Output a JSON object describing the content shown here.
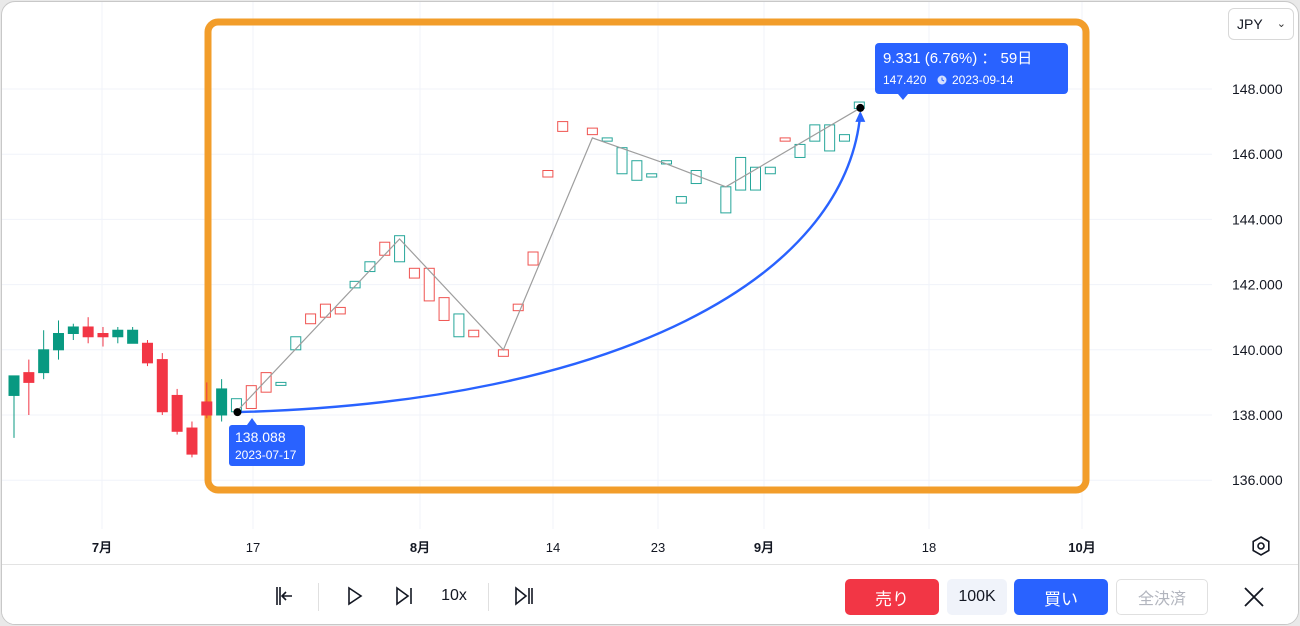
{
  "currency": {
    "selected": "JPY"
  },
  "chart_data": {
    "type": "candlestick",
    "y_axis": {
      "range": [
        134.7,
        149.3
      ],
      "ticks": [
        "148.000",
        "146.000",
        "144.000",
        "142.000",
        "140.000",
        "138.000",
        "136.000"
      ]
    },
    "x_axis": {
      "ticks": [
        "7月",
        "17",
        "8月",
        "14",
        "23",
        "9月",
        "18",
        "10月"
      ]
    },
    "candles": [
      {
        "bar": 0,
        "open": 138.6,
        "high": 138.9,
        "low": 137.3,
        "close": 139.2,
        "color": "green"
      },
      {
        "bar": 1,
        "open": 139.0,
        "high": 139.7,
        "low": 138.0,
        "close": 139.3,
        "color": "red"
      },
      {
        "bar": 2,
        "open": 139.3,
        "high": 140.6,
        "low": 139.1,
        "close": 140.0,
        "color": "green"
      },
      {
        "bar": 3,
        "open": 140.0,
        "high": 140.9,
        "low": 139.7,
        "close": 140.5,
        "color": "green"
      },
      {
        "bar": 4,
        "open": 140.5,
        "high": 140.8,
        "low": 140.3,
        "close": 140.7,
        "color": "green"
      },
      {
        "bar": 5,
        "open": 140.7,
        "high": 141.0,
        "low": 140.2,
        "close": 140.4,
        "color": "red"
      },
      {
        "bar": 6,
        "open": 140.5,
        "high": 140.7,
        "low": 140.1,
        "close": 140.4,
        "color": "red"
      },
      {
        "bar": 7,
        "open": 140.4,
        "high": 140.7,
        "low": 140.2,
        "close": 140.6,
        "color": "green"
      },
      {
        "bar": 8,
        "open": 140.6,
        "high": 140.7,
        "low": 140.3,
        "close": 140.2,
        "color": "green"
      },
      {
        "bar": 9,
        "open": 140.2,
        "high": 140.3,
        "low": 139.5,
        "close": 139.6,
        "color": "red"
      },
      {
        "bar": 10,
        "open": 139.7,
        "high": 139.9,
        "low": 138.0,
        "close": 138.1,
        "color": "red"
      },
      {
        "bar": 11,
        "open": 138.6,
        "high": 138.8,
        "low": 137.4,
        "close": 137.5,
        "color": "red"
      },
      {
        "bar": 12,
        "open": 137.6,
        "high": 137.8,
        "low": 136.7,
        "close": 136.8,
        "color": "red"
      },
      {
        "bar": 13,
        "open": 138.4,
        "high": 139.0,
        "low": 137.9,
        "close": 138.0,
        "color": "red"
      },
      {
        "bar": 14,
        "open": 138.0,
        "high": 139.1,
        "low": 137.8,
        "close": 138.8,
        "color": "green"
      },
      {
        "bar": 15,
        "open": 138.5,
        "high": 138.6,
        "low": 137.9,
        "close": 138.1,
        "color": "green"
      },
      {
        "bar": 16,
        "open": 138.2,
        "high": 139.0,
        "low": 138.1,
        "close": 138.9,
        "color": "red"
      },
      {
        "bar": 17,
        "open": 138.7,
        "high": 139.3,
        "low": 138.6,
        "close": 139.3,
        "color": "red"
      },
      {
        "bar": 18,
        "open": 139.0,
        "high": 139.1,
        "low": 138.9,
        "close": 139.0,
        "color": "green"
      },
      {
        "bar": 19,
        "open": 140.0,
        "high": 140.5,
        "low": 139.9,
        "close": 140.4,
        "color": "green"
      },
      {
        "bar": 20,
        "open": 140.8,
        "high": 141.1,
        "low": 140.8,
        "close": 141.1,
        "color": "red"
      },
      {
        "bar": 21,
        "open": 141.0,
        "high": 141.4,
        "low": 140.9,
        "close": 141.4,
        "color": "red"
      },
      {
        "bar": 22,
        "open": 141.1,
        "high": 141.3,
        "low": 140.9,
        "close": 141.3,
        "color": "red"
      },
      {
        "bar": 23,
        "open": 141.9,
        "high": 142.1,
        "low": 141.8,
        "close": 142.1,
        "color": "green"
      },
      {
        "bar": 24,
        "open": 142.4,
        "high": 142.7,
        "low": 142.3,
        "close": 142.7,
        "color": "green"
      },
      {
        "bar": 25,
        "open": 142.9,
        "high": 143.3,
        "low": 142.9,
        "close": 143.3,
        "color": "red"
      },
      {
        "bar": 26,
        "open": 142.7,
        "high": 143.5,
        "low": 142.7,
        "close": 143.5,
        "color": "green"
      },
      {
        "bar": 27,
        "open": 142.2,
        "high": 142.5,
        "low": 142.2,
        "close": 142.5,
        "color": "red"
      },
      {
        "bar": 28,
        "open": 141.5,
        "high": 142.5,
        "low": 141.5,
        "close": 142.5,
        "color": "red"
      },
      {
        "bar": 29,
        "open": 140.9,
        "high": 141.6,
        "low": 140.9,
        "close": 141.6,
        "color": "red"
      },
      {
        "bar": 30,
        "open": 140.4,
        "high": 141.1,
        "low": 140.4,
        "close": 141.1,
        "color": "green"
      },
      {
        "bar": 31,
        "open": 140.4,
        "high": 140.6,
        "low": 140.4,
        "close": 140.6,
        "color": "red"
      },
      {
        "bar": 33,
        "open": 139.8,
        "high": 140.0,
        "low": 139.8,
        "close": 140.0,
        "color": "red"
      },
      {
        "bar": 34,
        "open": 141.2,
        "high": 141.4,
        "low": 141.2,
        "close": 141.4,
        "color": "red"
      },
      {
        "bar": 35,
        "open": 142.6,
        "high": 143.0,
        "low": 142.6,
        "close": 143.0,
        "color": "red"
      },
      {
        "bar": 36,
        "open": 145.3,
        "high": 145.5,
        "low": 145.3,
        "close": 145.5,
        "color": "red"
      },
      {
        "bar": 37,
        "open": 146.7,
        "high": 147.0,
        "low": 146.7,
        "close": 147.0,
        "color": "red"
      },
      {
        "bar": 39,
        "open": 146.6,
        "high": 146.8,
        "low": 146.6,
        "close": 146.8,
        "color": "red"
      },
      {
        "bar": 40,
        "open": 146.4,
        "high": 146.5,
        "low": 146.4,
        "close": 146.5,
        "color": "green"
      },
      {
        "bar": 41,
        "open": 145.4,
        "high": 146.2,
        "low": 145.4,
        "close": 146.2,
        "color": "green"
      },
      {
        "bar": 42,
        "open": 145.2,
        "high": 145.8,
        "low": 145.2,
        "close": 145.8,
        "color": "green"
      },
      {
        "bar": 43,
        "open": 145.3,
        "high": 145.4,
        "low": 145.3,
        "close": 145.4,
        "color": "green"
      },
      {
        "bar": 44,
        "open": 145.7,
        "high": 145.8,
        "low": 145.7,
        "close": 145.8,
        "color": "green"
      },
      {
        "bar": 45,
        "open": 144.5,
        "high": 144.7,
        "low": 144.5,
        "close": 144.7,
        "color": "green"
      },
      {
        "bar": 46,
        "open": 145.1,
        "high": 145.5,
        "low": 145.1,
        "close": 145.5,
        "color": "green"
      },
      {
        "bar": 48,
        "open": 144.2,
        "high": 145.0,
        "low": 144.2,
        "close": 145.0,
        "color": "green"
      },
      {
        "bar": 49,
        "open": 144.9,
        "high": 145.9,
        "low": 144.9,
        "close": 145.9,
        "color": "green"
      },
      {
        "bar": 50,
        "open": 144.9,
        "high": 145.6,
        "low": 144.9,
        "close": 145.6,
        "color": "green"
      },
      {
        "bar": 51,
        "open": 145.4,
        "high": 145.6,
        "low": 145.4,
        "close": 145.6,
        "color": "green"
      },
      {
        "bar": 52,
        "open": 146.4,
        "high": 146.5,
        "low": 146.4,
        "close": 146.5,
        "color": "red"
      },
      {
        "bar": 53,
        "open": 145.9,
        "high": 146.3,
        "low": 145.9,
        "close": 146.3,
        "color": "green"
      },
      {
        "bar": 54,
        "open": 146.4,
        "high": 146.9,
        "low": 146.4,
        "close": 146.9,
        "color": "green"
      },
      {
        "bar": 55,
        "open": 146.1,
        "high": 146.9,
        "low": 146.1,
        "close": 146.9,
        "color": "green"
      },
      {
        "bar": 56,
        "open": 146.4,
        "high": 146.6,
        "low": 146.4,
        "close": 146.6,
        "color": "green"
      },
      {
        "bar": 57,
        "open": 147.4,
        "high": 147.6,
        "low": 147.4,
        "close": 147.6,
        "color": "green"
      }
    ],
    "zigzag": [
      {
        "bar": 15,
        "value": 138.1
      },
      {
        "bar": 26,
        "value": 143.4
      },
      {
        "bar": 33,
        "value": 140.0
      },
      {
        "bar": 39,
        "value": 146.5
      },
      {
        "bar": 44,
        "value": 145.7
      },
      {
        "bar": 48,
        "value": 145.0
      },
      {
        "bar": 57,
        "value": 147.4
      }
    ],
    "measure": {
      "start": {
        "bar": 15,
        "value": 138.088,
        "price_label": "138.088",
        "date_label": "2023-07-17"
      },
      "end": {
        "bar": 57,
        "value": 147.42,
        "headline": "9.331 (6.76%) ： 59日",
        "price_label": "147.420",
        "date_label": "2023-09-14"
      }
    },
    "colors": {
      "up": "#26a69a",
      "down": "#ef5350",
      "solid_up": "#089981",
      "solid_down": "#f23645",
      "highlight": "#f29d2a",
      "measure": "#2962ff"
    }
  },
  "toolbar": {
    "step_back_icon": "step-back-icon",
    "play_icon": "play-icon",
    "step_forward_icon": "step-forward-icon",
    "speed_label": "10x",
    "jump_end_icon": "jump-to-realtime-icon",
    "sell_label": "売り",
    "quantity_label": "100K",
    "buy_label": "買い",
    "close_all_label": "全決済",
    "close_icon": "close-icon"
  }
}
